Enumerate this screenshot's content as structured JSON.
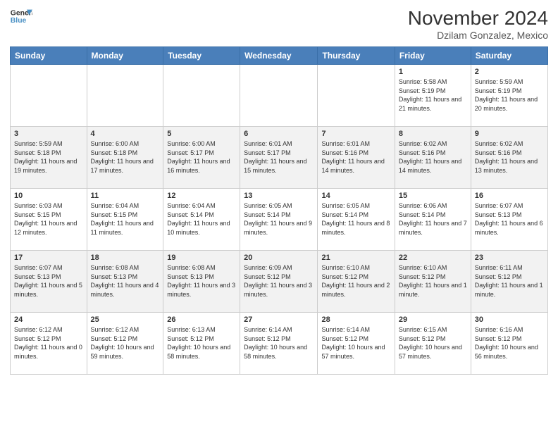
{
  "header": {
    "logo_line1": "General",
    "logo_line2": "Blue",
    "title": "November 2024",
    "subtitle": "Dzilam Gonzalez, Mexico"
  },
  "weekdays": [
    "Sunday",
    "Monday",
    "Tuesday",
    "Wednesday",
    "Thursday",
    "Friday",
    "Saturday"
  ],
  "weeks": [
    [
      {
        "day": "",
        "info": ""
      },
      {
        "day": "",
        "info": ""
      },
      {
        "day": "",
        "info": ""
      },
      {
        "day": "",
        "info": ""
      },
      {
        "day": "",
        "info": ""
      },
      {
        "day": "1",
        "info": "Sunrise: 5:58 AM\nSunset: 5:19 PM\nDaylight: 11 hours and 21 minutes."
      },
      {
        "day": "2",
        "info": "Sunrise: 5:59 AM\nSunset: 5:19 PM\nDaylight: 11 hours and 20 minutes."
      }
    ],
    [
      {
        "day": "3",
        "info": "Sunrise: 5:59 AM\nSunset: 5:18 PM\nDaylight: 11 hours and 19 minutes."
      },
      {
        "day": "4",
        "info": "Sunrise: 6:00 AM\nSunset: 5:18 PM\nDaylight: 11 hours and 17 minutes."
      },
      {
        "day": "5",
        "info": "Sunrise: 6:00 AM\nSunset: 5:17 PM\nDaylight: 11 hours and 16 minutes."
      },
      {
        "day": "6",
        "info": "Sunrise: 6:01 AM\nSunset: 5:17 PM\nDaylight: 11 hours and 15 minutes."
      },
      {
        "day": "7",
        "info": "Sunrise: 6:01 AM\nSunset: 5:16 PM\nDaylight: 11 hours and 14 minutes."
      },
      {
        "day": "8",
        "info": "Sunrise: 6:02 AM\nSunset: 5:16 PM\nDaylight: 11 hours and 14 minutes."
      },
      {
        "day": "9",
        "info": "Sunrise: 6:02 AM\nSunset: 5:16 PM\nDaylight: 11 hours and 13 minutes."
      }
    ],
    [
      {
        "day": "10",
        "info": "Sunrise: 6:03 AM\nSunset: 5:15 PM\nDaylight: 11 hours and 12 minutes."
      },
      {
        "day": "11",
        "info": "Sunrise: 6:04 AM\nSunset: 5:15 PM\nDaylight: 11 hours and 11 minutes."
      },
      {
        "day": "12",
        "info": "Sunrise: 6:04 AM\nSunset: 5:14 PM\nDaylight: 11 hours and 10 minutes."
      },
      {
        "day": "13",
        "info": "Sunrise: 6:05 AM\nSunset: 5:14 PM\nDaylight: 11 hours and 9 minutes."
      },
      {
        "day": "14",
        "info": "Sunrise: 6:05 AM\nSunset: 5:14 PM\nDaylight: 11 hours and 8 minutes."
      },
      {
        "day": "15",
        "info": "Sunrise: 6:06 AM\nSunset: 5:14 PM\nDaylight: 11 hours and 7 minutes."
      },
      {
        "day": "16",
        "info": "Sunrise: 6:07 AM\nSunset: 5:13 PM\nDaylight: 11 hours and 6 minutes."
      }
    ],
    [
      {
        "day": "17",
        "info": "Sunrise: 6:07 AM\nSunset: 5:13 PM\nDaylight: 11 hours and 5 minutes."
      },
      {
        "day": "18",
        "info": "Sunrise: 6:08 AM\nSunset: 5:13 PM\nDaylight: 11 hours and 4 minutes."
      },
      {
        "day": "19",
        "info": "Sunrise: 6:08 AM\nSunset: 5:13 PM\nDaylight: 11 hours and 3 minutes."
      },
      {
        "day": "20",
        "info": "Sunrise: 6:09 AM\nSunset: 5:12 PM\nDaylight: 11 hours and 3 minutes."
      },
      {
        "day": "21",
        "info": "Sunrise: 6:10 AM\nSunset: 5:12 PM\nDaylight: 11 hours and 2 minutes."
      },
      {
        "day": "22",
        "info": "Sunrise: 6:10 AM\nSunset: 5:12 PM\nDaylight: 11 hours and 1 minute."
      },
      {
        "day": "23",
        "info": "Sunrise: 6:11 AM\nSunset: 5:12 PM\nDaylight: 11 hours and 1 minute."
      }
    ],
    [
      {
        "day": "24",
        "info": "Sunrise: 6:12 AM\nSunset: 5:12 PM\nDaylight: 11 hours and 0 minutes."
      },
      {
        "day": "25",
        "info": "Sunrise: 6:12 AM\nSunset: 5:12 PM\nDaylight: 10 hours and 59 minutes."
      },
      {
        "day": "26",
        "info": "Sunrise: 6:13 AM\nSunset: 5:12 PM\nDaylight: 10 hours and 58 minutes."
      },
      {
        "day": "27",
        "info": "Sunrise: 6:14 AM\nSunset: 5:12 PM\nDaylight: 10 hours and 58 minutes."
      },
      {
        "day": "28",
        "info": "Sunrise: 6:14 AM\nSunset: 5:12 PM\nDaylight: 10 hours and 57 minutes."
      },
      {
        "day": "29",
        "info": "Sunrise: 6:15 AM\nSunset: 5:12 PM\nDaylight: 10 hours and 57 minutes."
      },
      {
        "day": "30",
        "info": "Sunrise: 6:16 AM\nSunset: 5:12 PM\nDaylight: 10 hours and 56 minutes."
      }
    ]
  ]
}
